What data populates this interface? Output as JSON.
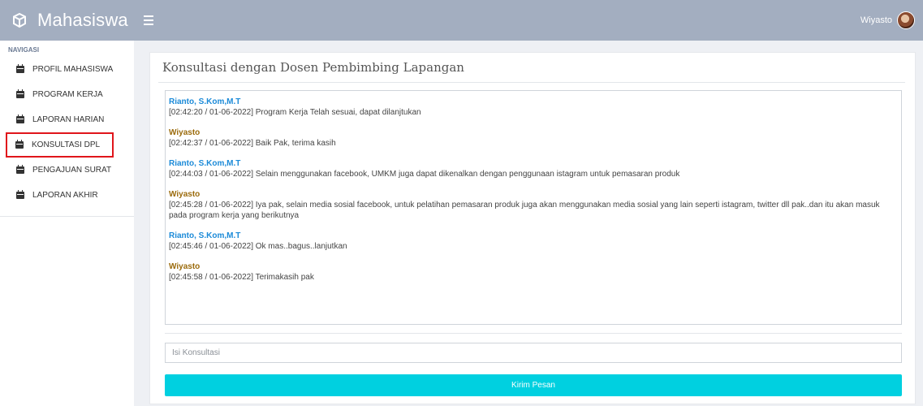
{
  "header": {
    "brand": "Mahasiswa",
    "brand_icon": "cube-icon",
    "menu_icon": "hamburger-icon",
    "user_name": "Wiyasto",
    "bar_color": "#a3aec0"
  },
  "sidebar": {
    "header": "NAVIGASI",
    "items": [
      {
        "label": "PROFIL MAHASISWA",
        "icon": "calendar-icon"
      },
      {
        "label": "PROGRAM KERJA",
        "icon": "calendar-icon"
      },
      {
        "label": "LAPORAN HARIAN",
        "icon": "calendar-icon"
      },
      {
        "label": "KONSULTASI DPL",
        "icon": "calendar-icon",
        "highlighted": true
      },
      {
        "label": "PENGAJUAN SURAT",
        "icon": "calendar-icon"
      },
      {
        "label": "LAPORAN AKHIR",
        "icon": "calendar-icon"
      }
    ],
    "highlight_color": "#e0151b"
  },
  "main": {
    "title": "Konsultasi dengan Dosen Pembimbing Lapangan",
    "messages": [
      {
        "sender": "Rianto, S.Kom,M.T",
        "role": "dpl",
        "text": "[02:42:20 / 01-06-2022] Program Kerja Telah sesuai, dapat dilanjtukan"
      },
      {
        "sender": "Wiyasto",
        "role": "mhs",
        "text": "[02:42:37 / 01-06-2022] Baik Pak, terima kasih"
      },
      {
        "sender": "Rianto, S.Kom,M.T",
        "role": "dpl",
        "text": "[02:44:03 / 01-06-2022] Selain menggunakan facebook, UMKM juga dapat dikenalkan dengan penggunaan istagram untuk pemasaran produk"
      },
      {
        "sender": "Wiyasto",
        "role": "mhs",
        "text": "[02:45:28 / 01-06-2022] Iya pak, selain media sosial facebook, untuk pelatihan pemasaran produk juga akan menggunakan media sosial yang lain seperti istagram, twitter dll pak..dan itu akan masuk pada program kerja yang berikutnya"
      },
      {
        "sender": "Rianto, S.Kom,M.T",
        "role": "dpl",
        "text": "[02:45:46 / 01-06-2022] Ok mas..bagus..lanjutkan"
      },
      {
        "sender": "Wiyasto",
        "role": "mhs",
        "text": "[02:45:58 / 01-06-2022] Terimakasih pak"
      }
    ],
    "input": {
      "placeholder": "Isi Konsultasi",
      "value": ""
    },
    "send_label": "Kirim Pesan",
    "colors": {
      "dpl_sender": "#1b8ad8",
      "mhs_sender": "#9b6b0c",
      "send_button": "#00d0e0"
    }
  }
}
